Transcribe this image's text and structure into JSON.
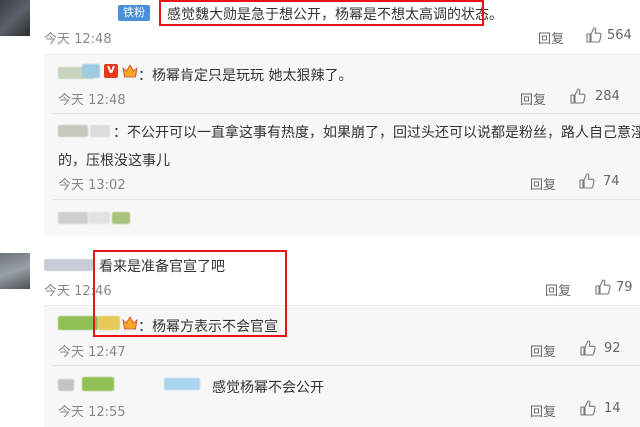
{
  "comments": [
    {
      "fan_badge": "铁粉",
      "text": "感觉魏大勋是急于想公开，杨幂是不想太高调的状态。",
      "time": "今天 12:48",
      "reply": "回复",
      "likes": "564"
    },
    {
      "text": "看来是准备官宣了吧",
      "time": "今天 12:46",
      "reply": "回复",
      "likes": "79"
    }
  ],
  "replies": [
    {
      "text": "：杨幂肯定只是玩玩 她太狠辣了。",
      "time": "今天 12:48",
      "reply": "回复",
      "likes": "284"
    },
    {
      "text_line1": "：不公开可以一直拿这事有热度，如果崩了，回过头还可以说都是粉丝，路人自己意淫",
      "text_line2": "的，压根没这事儿",
      "time": "今天 13:02",
      "reply": "回复",
      "likes": "74"
    },
    {
      "text": "：杨幂方表示不会官宣",
      "time": "今天 12:47",
      "reply": "回复",
      "likes": "92"
    },
    {
      "text": "感觉杨幂不会公开",
      "time": "今天 12:55",
      "reply": "回复",
      "likes": "14"
    }
  ],
  "icons": {
    "like": "thumbs-up-icon",
    "vip": "vip-badge-icon",
    "crown": "crown-icon"
  },
  "colors": {
    "highlight": "#e8141a",
    "fan_badge": "#4a90d9",
    "vip": "#e23b1f"
  }
}
